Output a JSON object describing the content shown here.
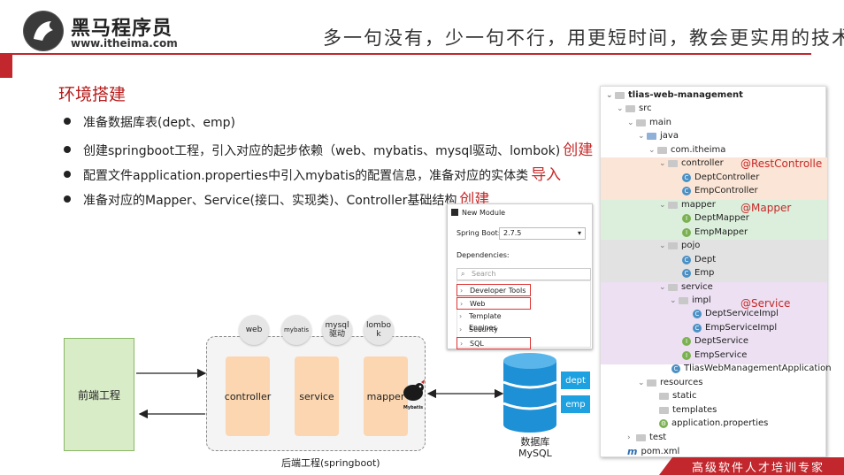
{
  "header": {
    "brand_name": "黑马程序员",
    "brand_url": "www.itheima.com",
    "slogan": "多一句没有，少一句不行，用更短时间，教会更实用的技术!"
  },
  "title": "环境搭建",
  "bullets": [
    {
      "text": "准备数据库表(dept、emp)",
      "note": ""
    },
    {
      "text": "创建springboot工程，引入对应的起步依赖（web、mybatis、mysql驱动、lombok)",
      "note": "创建"
    },
    {
      "text": "配置文件application.properties中引入mybatis的配置信息，准备对应的实体类",
      "note": "导入"
    },
    {
      "text": "准备对应的Mapper、Service(接口、实现类)、Controller基础结构",
      "note": "创建"
    }
  ],
  "diagram": {
    "frontend": "前端工程",
    "backend_label": "后端工程(springboot)",
    "deps": [
      "web",
      "mybatis",
      "mysql\n驱动",
      "lombo\nk"
    ],
    "layers": [
      "controller",
      "service",
      "mapper"
    ],
    "mybatis_logo": "Mybatis",
    "db_label_1": "数据库",
    "db_label_2": "MySQL",
    "tables": [
      "dept",
      "emp"
    ]
  },
  "module_panel": {
    "title": "New Module",
    "springboot_label": "Spring Boot:",
    "springboot_version": "2.7.5",
    "dependencies_label": "Dependencies:",
    "search_placeholder": "Search",
    "items": [
      "Developer Tools",
      "Web",
      "Template Engines",
      "Security",
      "SQL"
    ]
  },
  "tree": {
    "root": "tlias-web-management",
    "src": "src",
    "main": "main",
    "java": "java",
    "package": "com.itheima",
    "controller": "controller",
    "dept_controller": "DeptController",
    "emp_controller": "EmpController",
    "mapper": "mapper",
    "dept_mapper": "DeptMapper",
    "emp_mapper": "EmpMapper",
    "pojo": "pojo",
    "dept": "Dept",
    "emp": "Emp",
    "service": "service",
    "impl": "impl",
    "dept_service_impl": "DeptServiceImpl",
    "emp_service_impl": "EmpServiceImpl",
    "dept_service": "DeptService",
    "emp_service": "EmpService",
    "app": "TliasWebManagementApplication",
    "resources": "resources",
    "static": "static",
    "templates": "templates",
    "app_props": "application.properties",
    "test": "test",
    "pom": "pom.xml"
  },
  "annotations": {
    "controller": "@RestControlle",
    "mapper": "@Mapper",
    "service": "@Service"
  },
  "colors": {
    "brand_red": "#c1272d",
    "controller_band": "#fbe5d6",
    "mapper_band": "#dcefdc",
    "pojo_band": "#e2e2e2",
    "service_band": "#ece0f2"
  },
  "footer": "高级软件人才培训专家"
}
